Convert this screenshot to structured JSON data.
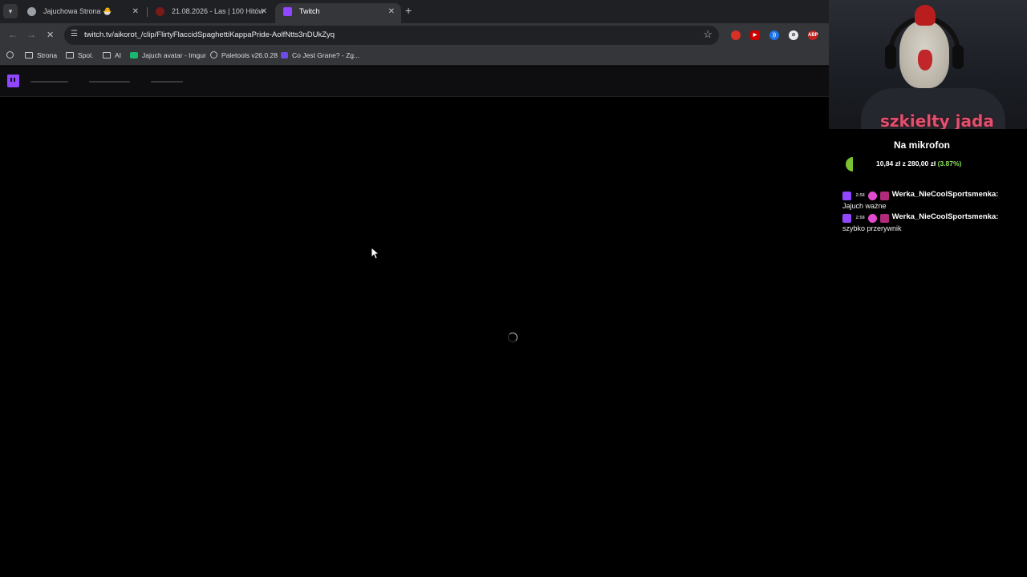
{
  "browser": {
    "tabs": [
      {
        "title": "Jajuchowa Strona 🐣",
        "active": false
      },
      {
        "title": "21.08.2026 - Las | 100 Hitów",
        "active": false
      },
      {
        "title": "Twitch",
        "active": true
      }
    ],
    "url": "twitch.tv/aikorot_/clip/FlirtyFlaccidSpaghettiKappaPride-AolfNtts3nDUkZyq",
    "bookmarks": [
      "Strona",
      "Spol.",
      "AI",
      "Jajuch avatar - Imgur",
      "Paletools v26.0.28",
      "Co Jest Grane? - Zg..."
    ],
    "extensions": [
      "ABP"
    ]
  },
  "overlay": {
    "shirt_text": "szkielty jada",
    "goal": {
      "title": "Na mikrofon",
      "current": "10,84 zł",
      "separator": "z",
      "target": "280,00 zł",
      "percent_label": "(3.87%)",
      "progress": 0.0387
    },
    "chat": [
      {
        "time": "2:58",
        "user": "Werka_NieCoolSportsmenka:",
        "message": "Jajuch ważne"
      },
      {
        "time": "2:58",
        "user": "Werka_NieCoolSportsmenka:",
        "message": "szybko przerywnik"
      }
    ]
  },
  "colors": {
    "twitch_purple": "#9146ff",
    "goal_green": "#8ce35a"
  }
}
